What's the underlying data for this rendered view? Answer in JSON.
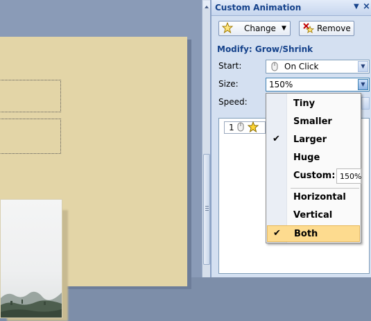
{
  "pane": {
    "title": "Custom Animation",
    "change_label": "Change",
    "remove_label": "Remove",
    "modify_label": "Modify: Grow/Shrink"
  },
  "fields": {
    "start_label": "Start:",
    "start_value": "On Click",
    "size_label": "Size:",
    "size_value": "150%",
    "speed_label": "Speed:"
  },
  "list": {
    "item_number": "1"
  },
  "menu": {
    "items": [
      {
        "label": "Tiny",
        "checked": false
      },
      {
        "label": "Smaller",
        "checked": false
      },
      {
        "label": "Larger",
        "checked": true
      },
      {
        "label": "Huge",
        "checked": false
      },
      {
        "label": "Custom:",
        "checked": false,
        "value": "150%"
      },
      {
        "label": "Horizontal",
        "checked": false
      },
      {
        "label": "Vertical",
        "checked": false
      },
      {
        "label": "Both",
        "checked": true
      }
    ]
  },
  "icons": {
    "change": "star-icon",
    "remove": "remove-effect-icon",
    "start": "mouse-icon",
    "list_trigger": "mouse-icon",
    "list_effect": "star-icon"
  },
  "colors": {
    "pane_bg": "#d4e0f1",
    "pane_title": "#15428b",
    "slide_bg": "#e3d5a7",
    "menu_highlight": "#fddb8f"
  }
}
